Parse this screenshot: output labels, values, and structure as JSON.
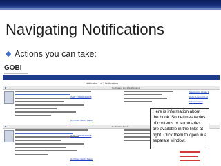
{
  "slide": {
    "title": "Navigating Notifications",
    "bullet": "Actions you can take:"
  },
  "screenshot": {
    "logo": "GOBI",
    "window_header": "Notification 1 of 2 Notifications",
    "row1": {
      "header_center": "Notification 1 of 2 Notifications",
      "isbn_link": "ISBN: 9780195301075",
      "actions": [
        "Selected for Library ▾",
        "Order (Library FILE)",
        "Future Interest"
      ],
      "status_link": "(1) Prices: Cloth / Paper"
    },
    "row2": {
      "header_center": "Notification 2 of 2",
      "isbn_link": "ISBN: 9780195337075",
      "actions": [
        "Selected for Library ▾",
        "Order (Library FILE)",
        "Future Interest"
      ],
      "status_link": "(1) Prices: Cloth / Paper"
    }
  },
  "callout": {
    "text": "Here is information about the book.  Sometimes tables of contents or summaries are available in the links at right.  Click them to open in a separate window."
  },
  "colors": {
    "header_bar": "#142a74",
    "nav_bar": "#1e3a8c",
    "bullet": "#3b6fd1",
    "link": "#1a3fc0"
  }
}
